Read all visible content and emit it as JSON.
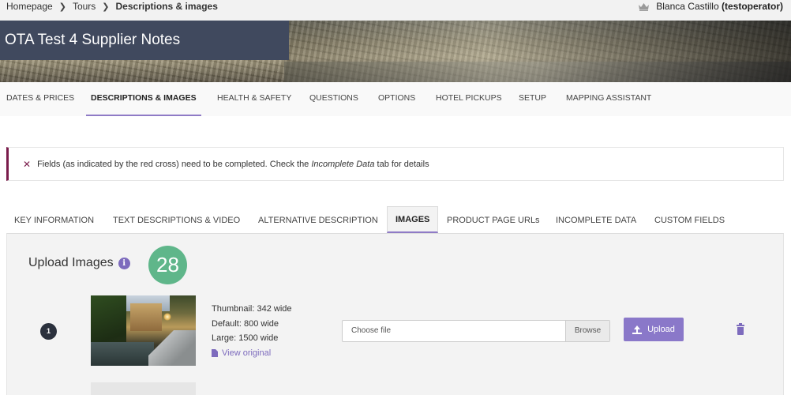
{
  "breadcrumb": {
    "items": [
      "Homepage",
      "Tours"
    ],
    "current": "Descriptions & images"
  },
  "user": {
    "name": "Blanca Castillo",
    "username": "(testoperator)"
  },
  "hero": {
    "title": "OTA Test 4 Supplier Notes"
  },
  "main_tabs": [
    {
      "label": "DATES & PRICES",
      "active": false
    },
    {
      "label": "DESCRIPTIONS & IMAGES",
      "active": true
    },
    {
      "label": "HEALTH & SAFETY",
      "active": false
    },
    {
      "label": "QUESTIONS",
      "active": false
    },
    {
      "label": "OPTIONS",
      "active": false
    },
    {
      "label": "HOTEL PICKUPS",
      "active": false
    },
    {
      "label": "SETUP",
      "active": false
    },
    {
      "label": "MAPPING ASSISTANT",
      "active": false
    }
  ],
  "alert": {
    "text_before": "Fields (as indicated by the red cross) need to be completed. Check the ",
    "emphasis": "Incomplete Data",
    "text_after": " tab for details"
  },
  "sub_tabs": [
    {
      "label": "KEY INFORMATION",
      "active": false
    },
    {
      "label": "TEXT DESCRIPTIONS & VIDEO",
      "active": false
    },
    {
      "label": "ALTERNATIVE DESCRIPTION",
      "active": false
    },
    {
      "label": "IMAGES",
      "active": true
    },
    {
      "label": "PRODUCT PAGE URLs",
      "active": false
    },
    {
      "label": "INCOMPLETE DATA",
      "active": false
    },
    {
      "label": "CUSTOM FIELDS",
      "active": false
    }
  ],
  "upload": {
    "title": "Upload Images",
    "count": "28",
    "images": [
      {
        "index": "1",
        "thumbnail_label": "Thumbnail: 342 wide",
        "default_label": "Default: 800 wide",
        "large_label": "Large: 1500 wide",
        "view_original": "View original",
        "file_placeholder": "Choose file",
        "browse_label": "Browse",
        "upload_label": "Upload"
      }
    ]
  },
  "colors": {
    "accent": "#8a78c9",
    "title_bg": "#40495e",
    "badge_green": "#5fb68a",
    "alert_border": "#7a1c4b"
  }
}
